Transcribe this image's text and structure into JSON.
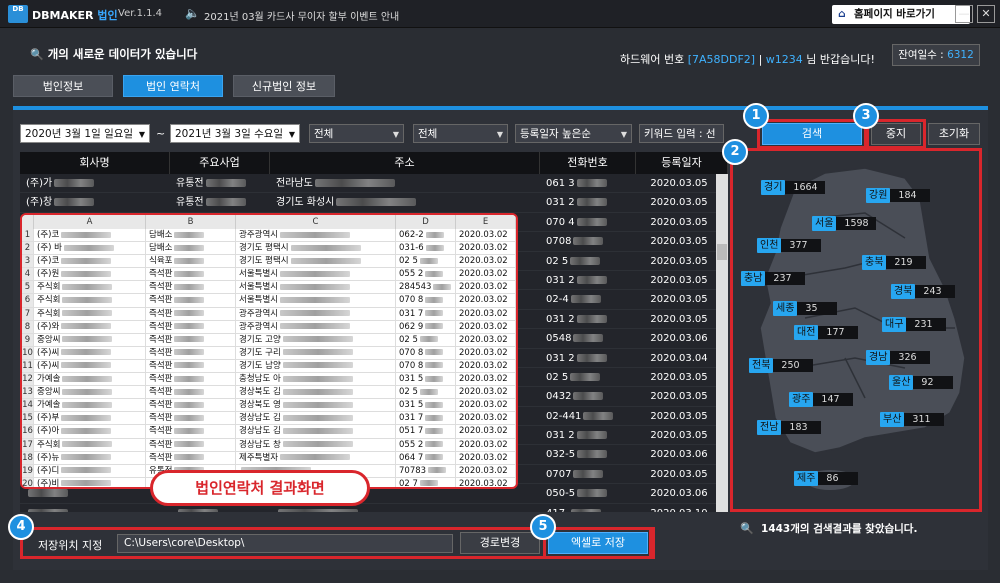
{
  "app": {
    "logo": "DB",
    "name": "DBMAKER",
    "corp": "법인",
    "version": "Ver.1.1.4",
    "notice": "2021년 03월 카드사 무이자 할부 이벤트 안내",
    "homepage": "홈페이지 바로가기"
  },
  "header": {
    "new_data": "개의 새로운 데이터가 있습니다",
    "hw_label": "하드웨어 번호",
    "hw_id": "[7A58DDF2]",
    "user": "w1234",
    "greeting": "님 반갑습니다!",
    "remain_label": "잔여일수 : ",
    "remain_value": "6312"
  },
  "tabs": [
    {
      "label": "법인정보"
    },
    {
      "label": "법인 연락처"
    },
    {
      "label": "신규법인 정보"
    }
  ],
  "filters": {
    "date_from": "2020년  3월  1일 일요일",
    "date_to": "2021년  3월  3일 수요일",
    "tilde": "~",
    "region": "전체",
    "industry": "전체",
    "sort": "등록일자 높은순",
    "keyword": "키워드 입력 : 선택"
  },
  "buttons": {
    "search": "검색",
    "stop": "중지",
    "reset": "초기화",
    "change_path": "경로변경",
    "save_excel": "엑셀로 저장"
  },
  "table": {
    "columns": [
      "회사명",
      "주요사업",
      "주소",
      "전화번호",
      "등록일자"
    ],
    "rows": [
      [
        "(주)가",
        "유통전",
        "전라남도",
        "061  3",
        "2020.03.05"
      ],
      [
        "(주)창",
        "유통전",
        "경기도 화성시",
        "031 2",
        "2020.03.05"
      ],
      [
        "",
        "",
        "",
        "070 4",
        "2020.03.05"
      ],
      [
        "",
        "",
        "",
        "0708",
        "2020.03.05"
      ],
      [
        "",
        "",
        "",
        "02  5",
        "2020.03.05"
      ],
      [
        "",
        "",
        "",
        "031 2",
        "2020.03.05"
      ],
      [
        "",
        "",
        "",
        "02-4",
        "2020.03.05"
      ],
      [
        "",
        "",
        "",
        "031 2",
        "2020.03.05"
      ],
      [
        "",
        "",
        "",
        "0548",
        "2020.03.06"
      ],
      [
        "",
        "",
        "",
        "031 2",
        "2020.03.04"
      ],
      [
        "",
        "",
        "",
        "02  5",
        "2020.03.05"
      ],
      [
        "",
        "",
        "",
        "0432",
        "2020.03.05"
      ],
      [
        "",
        "",
        "",
        "02-441",
        "2020.03.05"
      ],
      [
        "",
        "",
        "",
        "031 2",
        "2020.03.05"
      ],
      [
        "",
        "",
        "",
        "032-5",
        "2020.03.06"
      ],
      [
        "",
        "",
        "",
        "0707",
        "2020.03.05"
      ],
      [
        "",
        "",
        "",
        "050-5",
        "2020.03.06"
      ],
      [
        "",
        "",
        "",
        "417-",
        "2020.03.10"
      ],
      [
        "",
        "",
        "",
        "0314",
        "2020.03.05"
      ],
      [
        "",
        "",
        "",
        "054-7",
        "2020.03.05"
      ],
      [
        "",
        "",
        "",
        "055-5",
        "2020.03.05"
      ],
      [
        "(주)제",
        "",
        "",
        "0323",
        "2020.03.06"
      ]
    ]
  },
  "excel": {
    "cols": [
      "A",
      "B",
      "C",
      "D",
      "E"
    ],
    "rows": [
      [
        "1",
        "(주)코",
        "담배소",
        "광주광역시",
        "062-2",
        "2020.03.02"
      ],
      [
        "2",
        "(주) 바",
        "담배소",
        "경기도 평택시",
        "031-6",
        "2020.03.02"
      ],
      [
        "3",
        "(주)코",
        "식육포",
        "경기도 평택시",
        "02  5",
        "2020.03.02"
      ],
      [
        "4",
        "(주)원",
        "즉석판",
        "서울특별시",
        "055 2",
        "2020.03.02"
      ],
      [
        "5",
        "주식회",
        "즉석판",
        "서울특별시",
        "284543",
        "2020.03.02"
      ],
      [
        "6",
        "주식회",
        "즉석판",
        "서울특별시",
        "070 8",
        "2020.03.02"
      ],
      [
        "7",
        "주식회",
        "즉석판",
        "광주광역시",
        "031 7",
        "2020.03.02"
      ],
      [
        "8",
        "(주)와",
        "즉석판",
        "광주광역시",
        "062 9",
        "2020.03.02"
      ],
      [
        "9",
        "중앙씨",
        "즉석판",
        "경기도 고양",
        "02  5",
        "2020.03.02"
      ],
      [
        "10",
        "(주)씨",
        "즉석판",
        "경기도 구리",
        "070 8",
        "2020.03.02"
      ],
      [
        "11",
        "(주)씨",
        "즉석판",
        "경기도 남양",
        "070 8",
        "2020.03.02"
      ],
      [
        "12",
        "가예솔",
        "즉석판",
        "충청남도 아",
        "031 5",
        "2020.03.02"
      ],
      [
        "13",
        "중앙씨",
        "즉석판",
        "경상북도 김",
        "02  5",
        "2020.03.02"
      ],
      [
        "14",
        "가예솔",
        "즉석판",
        "경상북도 영",
        "031 5",
        "2020.03.02"
      ],
      [
        "15",
        "(주)부",
        "즉석판",
        "경상남도 김",
        "031 7",
        "2020.03.02"
      ],
      [
        "16",
        "(주)아",
        "즉석판",
        "경상남도 김",
        "051 7",
        "2020.03.02"
      ],
      [
        "17",
        "주식회",
        "즉석판",
        "경상남도 창",
        "055 2",
        "2020.03.02"
      ],
      [
        "18",
        "(주)뉴",
        "즉석판",
        "제주특별자",
        "064 7",
        "2020.03.02"
      ],
      [
        "19",
        "(주)디",
        "유통전",
        "",
        "70783",
        "2020.03.02"
      ],
      [
        "20",
        "(주)비",
        "",
        "",
        "02 7",
        "2020.03.02"
      ]
    ]
  },
  "caption": "법인연락처 결과화면",
  "map": {
    "regions": [
      {
        "name": "경기",
        "value": "1664"
      },
      {
        "name": "강원",
        "value": "184"
      },
      {
        "name": "서울",
        "value": "1598"
      },
      {
        "name": "인천",
        "value": "377"
      },
      {
        "name": "충북",
        "value": "219"
      },
      {
        "name": "충남",
        "value": "237"
      },
      {
        "name": "경북",
        "value": "243"
      },
      {
        "name": "세종",
        "value": "35"
      },
      {
        "name": "대구",
        "value": "231"
      },
      {
        "name": "대전",
        "value": "177"
      },
      {
        "name": "경남",
        "value": "326"
      },
      {
        "name": "전북",
        "value": "250"
      },
      {
        "name": "울산",
        "value": "92"
      },
      {
        "name": "광주",
        "value": "147"
      },
      {
        "name": "부산",
        "value": "311"
      },
      {
        "name": "전남",
        "value": "183"
      },
      {
        "name": "제주",
        "value": "86"
      }
    ]
  },
  "result": "1443개의 검색결과를 찾았습니다.",
  "save": {
    "label": "저장위치 지정",
    "path": "C:\\Users\\core\\Desktop\\"
  },
  "markers": [
    "1",
    "2",
    "3",
    "4",
    "5"
  ],
  "colors": {
    "accent": "#1e90e0",
    "highlight": "#d9262c",
    "region_label": "#27a6f0"
  }
}
